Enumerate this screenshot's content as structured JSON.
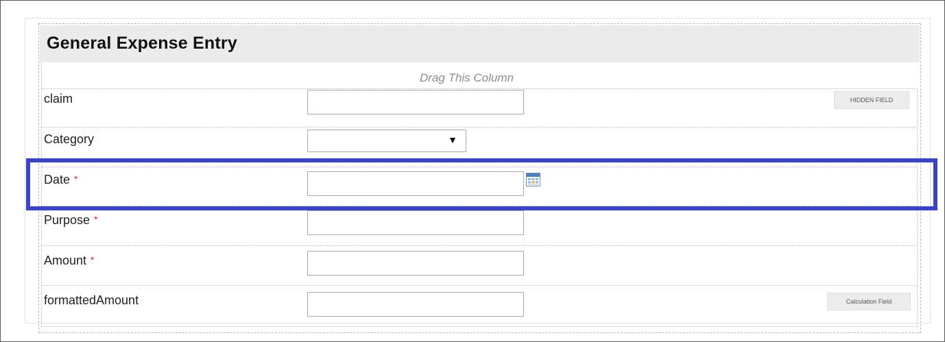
{
  "form": {
    "title": "General Expense Entry",
    "drag_column_label": "Drag This Column"
  },
  "fields": [
    {
      "label": "claim",
      "required": false,
      "type": "text",
      "value": "",
      "tag": "HIDDEN FIELD"
    },
    {
      "label": "Category",
      "required": false,
      "type": "select",
      "selected": ""
    },
    {
      "label": "Date",
      "required": true,
      "type": "date",
      "value": ""
    },
    {
      "label": "Purpose",
      "required": true,
      "type": "text",
      "value": ""
    },
    {
      "label": "Amount",
      "required": true,
      "type": "text",
      "value": ""
    },
    {
      "label": "formattedAmount",
      "required": false,
      "type": "text",
      "value": "",
      "tag": "Calculation Field"
    }
  ],
  "required_marker": "*",
  "select_arrow": "▼",
  "icons": {
    "date_picker": "calendar-icon",
    "category_dropdown": "dropdown-arrow-icon"
  },
  "colors": {
    "highlight": "#3b44c2",
    "required": "#e02020",
    "header_bg": "#ebebeb",
    "drag_label": "#8d8d8d"
  }
}
